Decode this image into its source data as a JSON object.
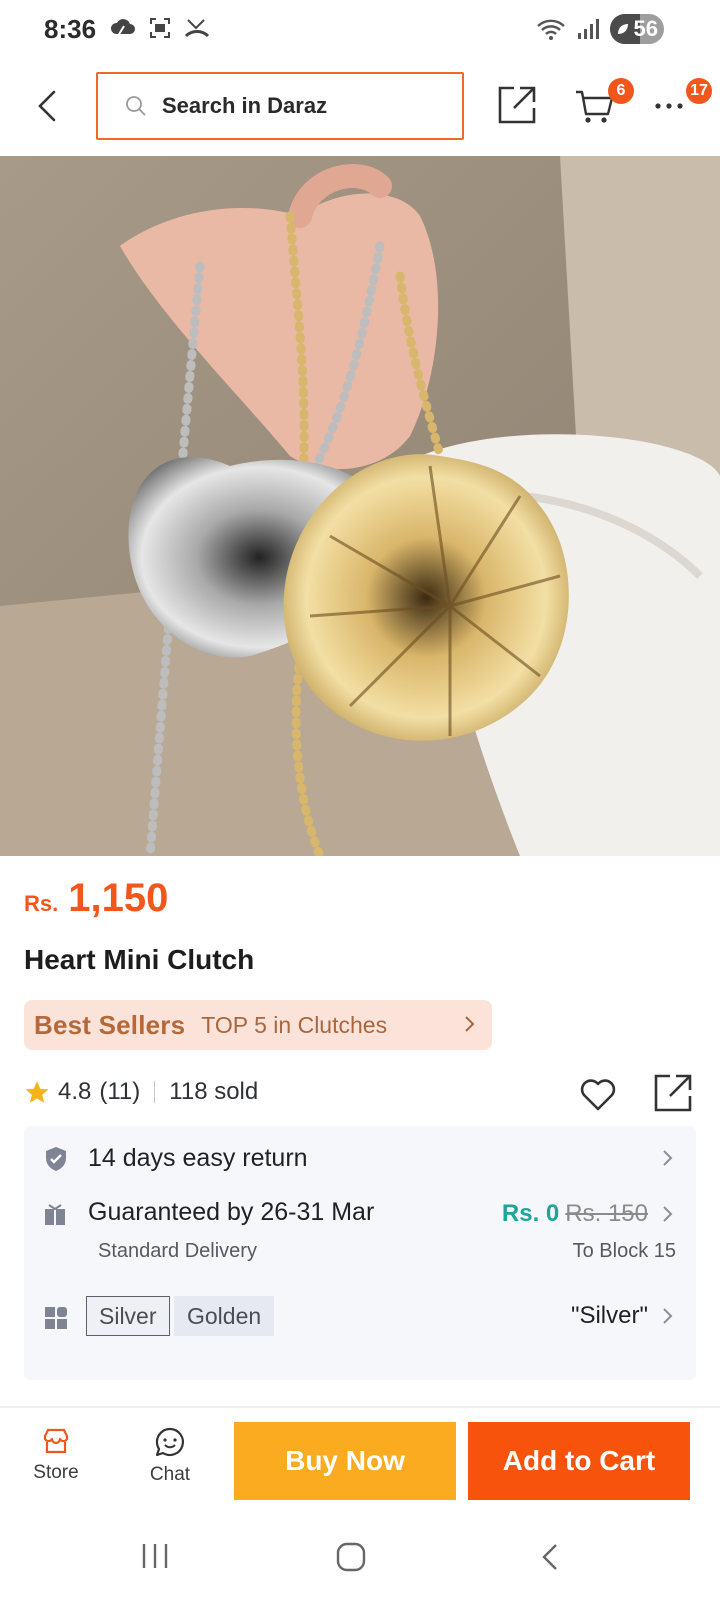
{
  "status_bar": {
    "time": "8:36",
    "battery": "56",
    "battery_level": 0.56
  },
  "header": {
    "search_placeholder": "Search in Daraz",
    "cart_badge": "6",
    "more_badge": "17"
  },
  "product": {
    "currency": "Rs.",
    "price": "1,150",
    "title": "Heart Mini Clutch",
    "bestseller_label": "Best Sellers",
    "bestseller_text": "TOP 5 in Clutches",
    "rating": "4.8",
    "rating_count": "(11)",
    "sold": "118 sold"
  },
  "details": {
    "return_text": "14 days easy return",
    "delivery_text": "Guaranteed by 26-31 Mar",
    "delivery_sub": "Standard Delivery",
    "shipping_free": "Rs. 0",
    "shipping_old": "Rs. 150",
    "shipping_dest": "To Block 15",
    "variants": [
      "Silver",
      "Golden"
    ],
    "variant_selected": "\"Silver\""
  },
  "actions": {
    "store_label": "Store",
    "chat_label": "Chat",
    "buy_label": "Buy Now",
    "cart_label": "Add to Cart"
  },
  "colors": {
    "accent": "#f1571d",
    "buy_now": "#fbab1f",
    "add_to_cart": "#f8530d",
    "free_shipping": "#1ea59a"
  }
}
